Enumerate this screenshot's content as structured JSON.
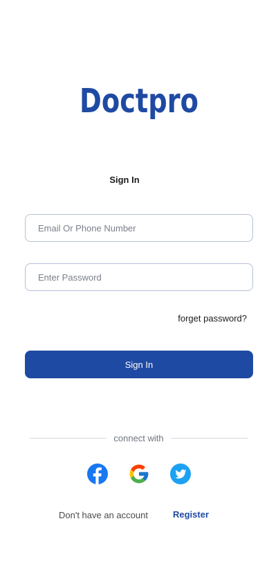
{
  "brand": {
    "logo_text": "Doctpro",
    "color": "#1f4aa3"
  },
  "form": {
    "title": "Sign In",
    "email_placeholder": "Email Or Phone Number",
    "password_placeholder": "Enter Password",
    "forgot_label": "forget password?",
    "submit_label": "Sign In",
    "submit_color": "#1f4aa3"
  },
  "social": {
    "divider_label": "connect with",
    "providers": [
      {
        "name": "facebook",
        "icon": "facebook-icon",
        "color": "#1877f2"
      },
      {
        "name": "google",
        "icon": "google-icon",
        "color": "#4285f4"
      },
      {
        "name": "twitter",
        "icon": "twitter-icon",
        "color": "#1da1f2"
      }
    ]
  },
  "footer": {
    "prompt": "Don't have an account",
    "register_label": "Register"
  }
}
